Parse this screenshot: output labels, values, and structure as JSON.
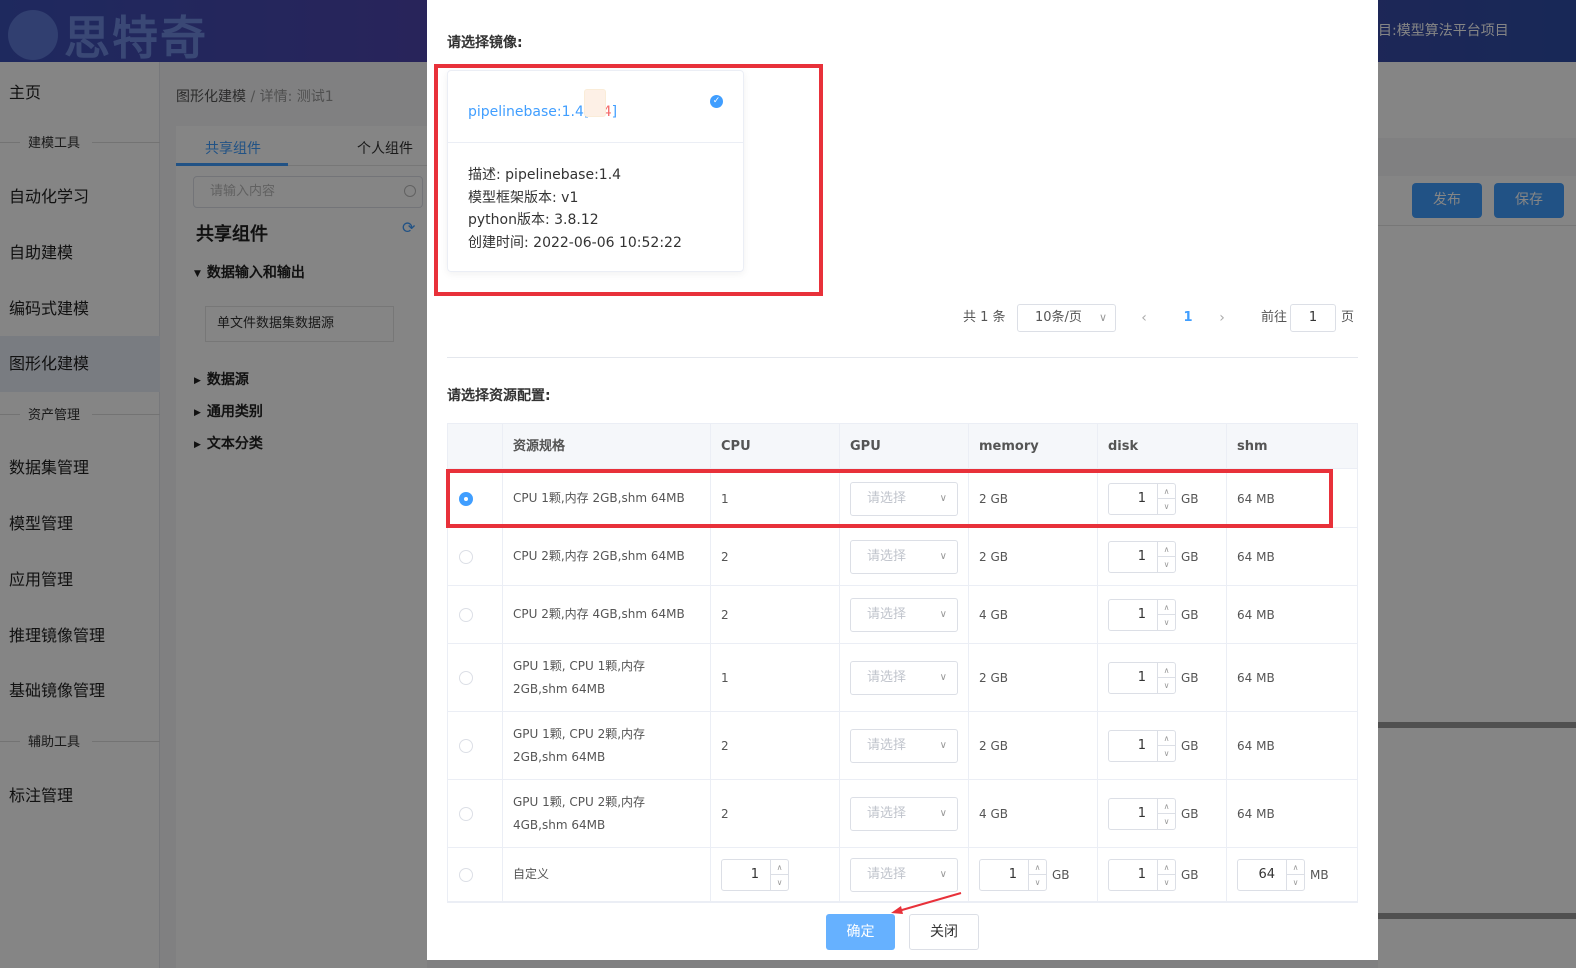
{
  "app": {
    "logo_text": "思特奇",
    "project_title": "目:模型算法平台项目"
  },
  "sidebar": {
    "items": [
      {
        "label": "主页"
      },
      {
        "label": "建模工具",
        "group": true
      },
      {
        "label": "自动化学习"
      },
      {
        "label": "自助建模"
      },
      {
        "label": "编码式建模"
      },
      {
        "label": "图形化建模",
        "active": true
      },
      {
        "label": "资产管理",
        "group": true
      },
      {
        "label": "数据集管理"
      },
      {
        "label": "模型管理"
      },
      {
        "label": "应用管理"
      },
      {
        "label": "推理镜像管理"
      },
      {
        "label": "基础镜像管理"
      },
      {
        "label": "辅助工具",
        "group": true
      },
      {
        "label": "标注管理"
      }
    ]
  },
  "breadcrumb": {
    "root": "图形化建模",
    "sep": "/",
    "current": "详情: 测试1"
  },
  "component_panel": {
    "tabs": [
      "共享组件",
      "个人组件"
    ],
    "search_placeholder": "请输入内容",
    "title": "共享组件",
    "tree": [
      {
        "label": "数据输入和输出",
        "expanded": true,
        "children": [
          "单文件数据集数据源"
        ]
      },
      {
        "label": "数据源"
      },
      {
        "label": "通用类别"
      },
      {
        "label": "文本分类"
      }
    ]
  },
  "toolbar": {
    "publish_label": "发布",
    "save_label": "保存"
  },
  "dialog": {
    "image_section_label": "请选择镜像:",
    "image_card": {
      "name": "pipelinebase:1.4",
      "version": "1.4",
      "selected": true,
      "description": "描述: pipelinebase:1.4",
      "framework": "模型框架版本: v1",
      "python": "python版本: 3.8.12",
      "created": "创建时间: 2022-06-06 10:52:22"
    },
    "pagination": {
      "total_label": "共 1 条",
      "page_size": "10条/页",
      "prev": "‹",
      "next": "›",
      "current": "1",
      "goto_prefix": "前往",
      "goto_value": "1",
      "goto_suffix": "页"
    },
    "resource_section_label": "请选择资源配置:",
    "table": {
      "headers": [
        "资源规格",
        "CPU",
        "GPU",
        "memory",
        "disk",
        "shm"
      ],
      "gpu_placeholder": "请选择",
      "unit_gb": "GB",
      "unit_mb": "MB",
      "rows": [
        {
          "spec": "CPU 1颗,内存 2GB,shm 64MB",
          "cpu": "1",
          "memory": "2 GB",
          "disk": "1",
          "shm": "64 MB",
          "selected": true
        },
        {
          "spec": "CPU 2颗,内存 2GB,shm 64MB",
          "cpu": "2",
          "memory": "2 GB",
          "disk": "1",
          "shm": "64 MB",
          "selected": false
        },
        {
          "spec": "CPU 2颗,内存 4GB,shm 64MB",
          "cpu": "2",
          "memory": "4 GB",
          "disk": "1",
          "shm": "64 MB",
          "selected": false
        },
        {
          "spec": "GPU 1颗, CPU 1颗,内存 2GB,shm 64MB",
          "cpu": "1",
          "memory": "2 GB",
          "disk": "1",
          "shm": "64 MB",
          "selected": false
        },
        {
          "spec": "GPU 1颗, CPU 2颗,内存 2GB,shm 64MB",
          "cpu": "2",
          "memory": "2 GB",
          "disk": "1",
          "shm": "64 MB",
          "selected": false
        },
        {
          "spec": "GPU 1颗, CPU 2颗,内存 4GB,shm 64MB",
          "cpu": "2",
          "memory": "4 GB",
          "disk": "1",
          "shm": "64 MB",
          "selected": false
        }
      ],
      "custom_row": {
        "spec": "自定义",
        "cpu": "1",
        "memory": "1",
        "disk": "1",
        "shm": "64"
      }
    },
    "confirm_label": "确定",
    "close_label": "关闭"
  },
  "colors": {
    "accent": "#409eff",
    "highlight": "#e8313a"
  }
}
